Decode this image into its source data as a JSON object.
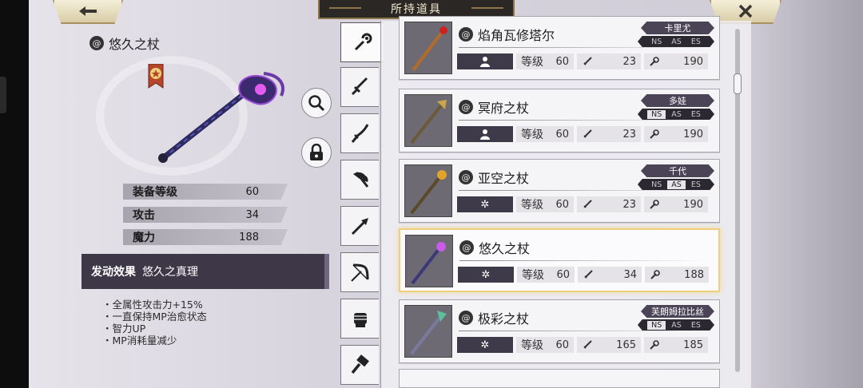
{
  "header": {
    "title": "所持道具",
    "back_icon": "arrow-left-icon",
    "close_icon": "close-x-icon"
  },
  "detail": {
    "name": "悠久之杖",
    "stats": [
      {
        "label": "装备等级",
        "value": "60"
      },
      {
        "label": "攻击",
        "value": "34"
      },
      {
        "label": "魔力",
        "value": "188"
      }
    ],
    "effect_label": "发动效果",
    "effect_name": "悠久之真理",
    "effects": [
      "・全属性攻击力+15%",
      "・一直保持MP治愈状态",
      "・智力UP",
      "・MP消耗量减少"
    ]
  },
  "tabs": [
    "staff-icon",
    "sword-icon",
    "katana-icon",
    "axe-icon",
    "spear-icon",
    "bow-icon",
    "fist-icon",
    "hammer-icon"
  ],
  "list": {
    "level_label": "等级",
    "items": [
      {
        "name": "焰角瓦修塔尔",
        "owner": "卡里尤",
        "type": "person",
        "level": "60",
        "atk": "23",
        "mag": "190",
        "ranks": [
          "NS",
          "AS",
          "ES"
        ],
        "active_rank": ""
      },
      {
        "name": "冥府之杖",
        "owner": "多娃",
        "type": "person",
        "level": "60",
        "atk": "23",
        "mag": "190",
        "ranks": [
          "NS",
          "AS",
          "ES"
        ],
        "active_rank": "NS"
      },
      {
        "name": "亚空之杖",
        "owner": "千代",
        "type": "star",
        "level": "60",
        "atk": "23",
        "mag": "190",
        "ranks": [
          "NS",
          "AS",
          "ES"
        ],
        "active_rank": "AS"
      },
      {
        "name": "悠久之杖",
        "owner": "",
        "type": "star",
        "level": "60",
        "atk": "34",
        "mag": "188",
        "ranks": [],
        "active_rank": ""
      },
      {
        "name": "极彩之杖",
        "owner": "芙朗姆拉比丝",
        "type": "star",
        "level": "60",
        "atk": "165",
        "mag": "185",
        "ranks": [
          "NS",
          "AS",
          "ES"
        ],
        "active_rank": "NS"
      }
    ]
  },
  "colors": {
    "accent_gold": "#f0cf7a",
    "panel_dark": "#3d3748",
    "tag_purple": "#4b4457"
  }
}
